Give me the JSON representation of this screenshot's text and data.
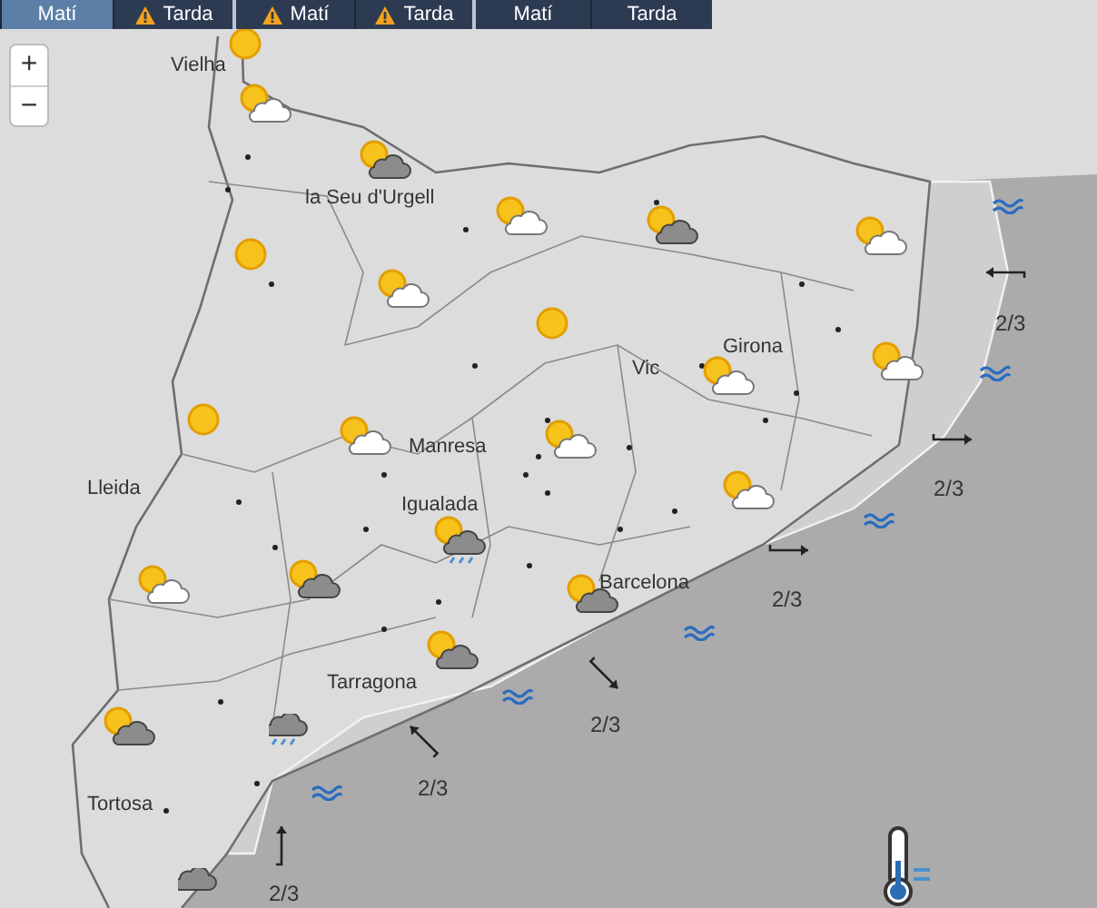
{
  "tabs": [
    {
      "label": "Matí",
      "warning": false,
      "selected": true
    },
    {
      "label": "Tarda",
      "warning": true,
      "selected": false
    },
    {
      "label": "Matí",
      "warning": true,
      "selected": false
    },
    {
      "label": "Tarda",
      "warning": true,
      "selected": false
    },
    {
      "label": "Matí",
      "warning": false,
      "selected": false
    },
    {
      "label": "Tarda",
      "warning": false,
      "selected": false
    }
  ],
  "zoom_controls": [
    "+",
    "−"
  ],
  "cities": [
    "Vielha",
    "la Seu d'Urgell",
    "Lleida",
    "Manresa",
    "Igualada",
    "Vic",
    "Girona",
    "Tarragona",
    "Tortosa",
    "Barcelona"
  ],
  "forecast_icons": [
    {
      "kind": "sun"
    },
    {
      "kind": "sun-cloud"
    },
    {
      "kind": "sun-dark-cloud"
    },
    {
      "kind": "sun-cloud"
    },
    {
      "kind": "sun-dark-cloud"
    },
    {
      "kind": "sun-cloud"
    },
    {
      "kind": "sun"
    },
    {
      "kind": "sun-cloud"
    },
    {
      "kind": "sun"
    },
    {
      "kind": "sun-cloud"
    },
    {
      "kind": "sun-cloud"
    },
    {
      "kind": "sun"
    },
    {
      "kind": "sun-cloud"
    },
    {
      "kind": "sun-cloud"
    },
    {
      "kind": "sun-cloud"
    },
    {
      "kind": "sun-dark-cloud-rain"
    },
    {
      "kind": "sun-cloud"
    },
    {
      "kind": "sun-dark-cloud"
    },
    {
      "kind": "sun-dark-cloud"
    },
    {
      "kind": "sun-dark-cloud"
    },
    {
      "kind": "sun-dark-cloud"
    },
    {
      "kind": "dark-cloud-rain"
    },
    {
      "kind": "dark-cloud"
    }
  ],
  "wind": [
    {
      "kind": "west",
      "reading": "2/3"
    },
    {
      "kind": "east",
      "reading": "2/3"
    },
    {
      "kind": "east",
      "reading": "2/3"
    },
    {
      "kind": "southeast",
      "reading": "2/3"
    },
    {
      "kind": "northwest",
      "reading": "2/3"
    },
    {
      "kind": "north",
      "reading": "2/3"
    }
  ]
}
